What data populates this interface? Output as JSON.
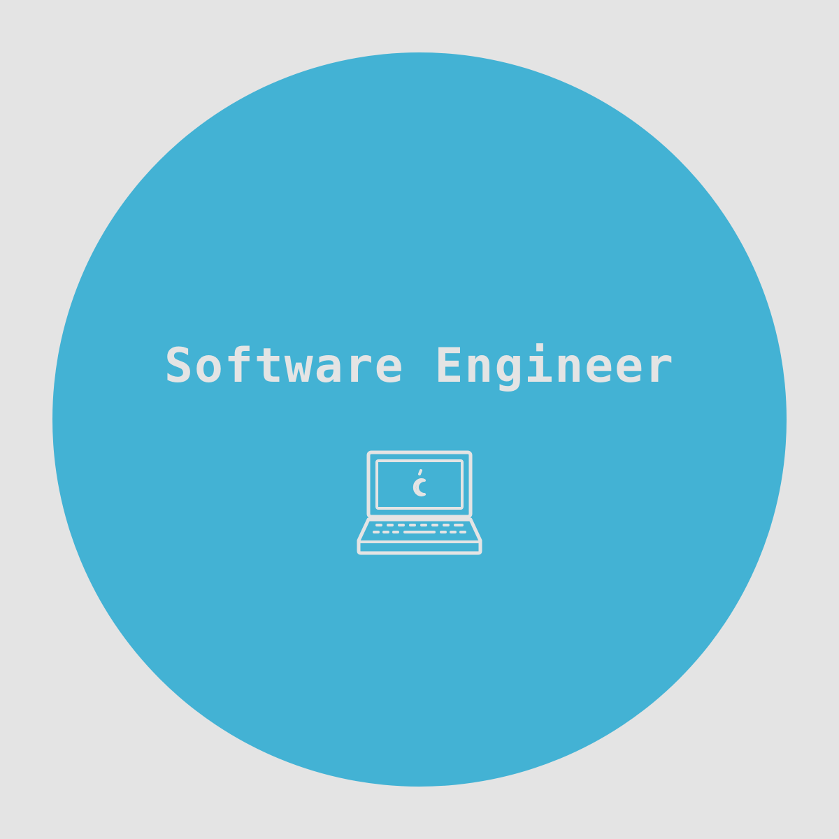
{
  "colors": {
    "background": "#e4e4e4",
    "circle": "#43b2d4",
    "foreground": "#e4e4e4"
  },
  "title": "Software Engineer",
  "icon": "laptop-icon"
}
